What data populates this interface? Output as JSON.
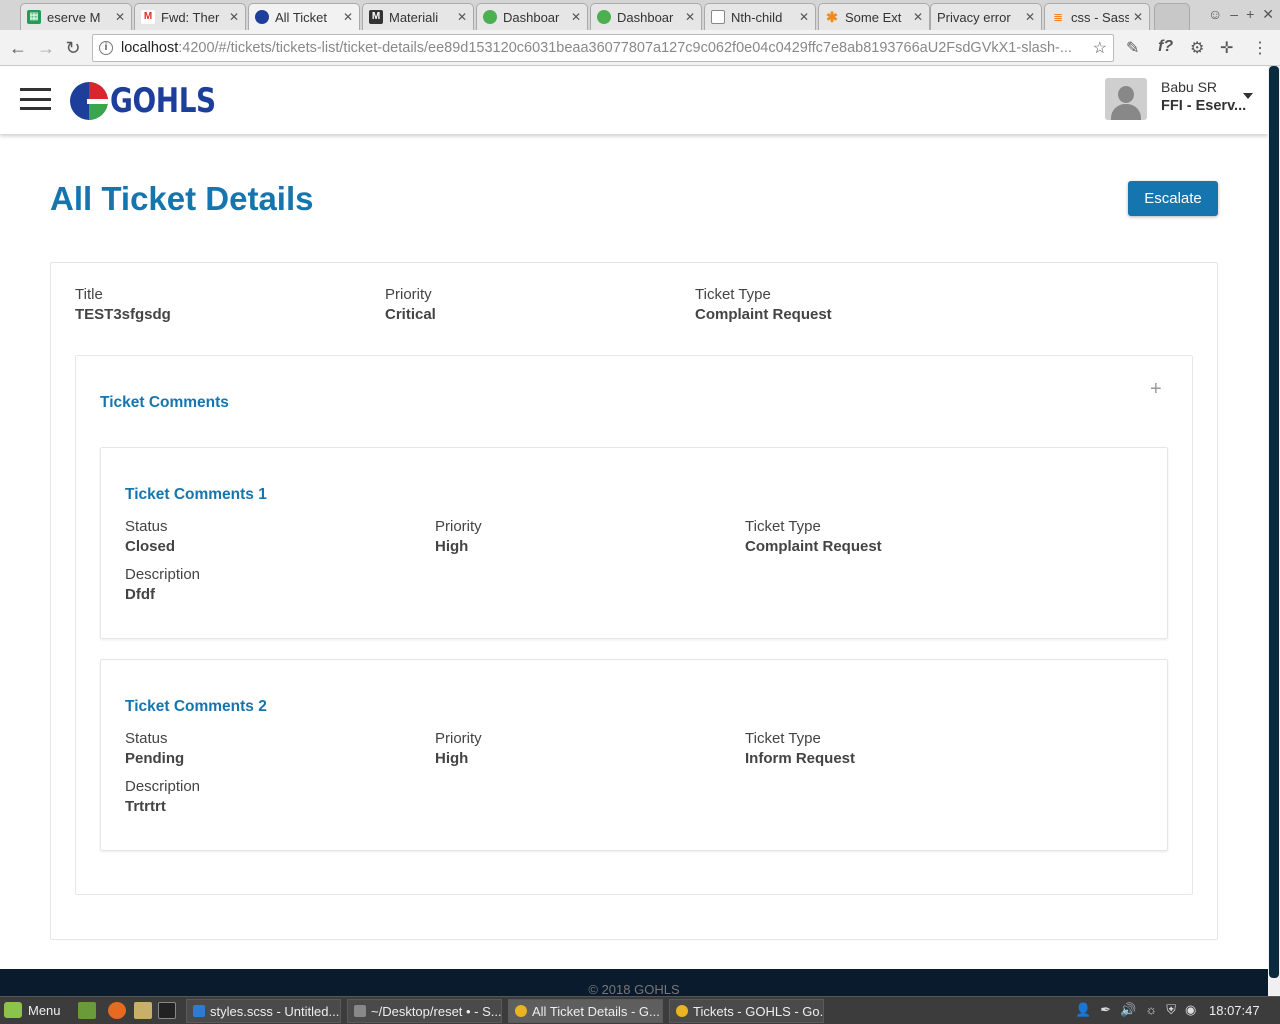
{
  "browser": {
    "tabs": [
      {
        "label": "eserve M",
        "icon": "sheets-icon",
        "color": "#1e9e57"
      },
      {
        "label": "Fwd: Ther",
        "icon": "gmail-icon",
        "color": "#d93025"
      },
      {
        "label": "All Ticket",
        "icon": "gohls-icon",
        "color": "#1d3f9b",
        "active": true
      },
      {
        "label": "Materiali",
        "icon": "materialize-icon",
        "color": "#333333"
      },
      {
        "label": "Dashboar",
        "icon": "dashboard-icon",
        "color": "#4caf50"
      },
      {
        "label": "Dashboar",
        "icon": "dashboard-icon",
        "color": "#4caf50"
      },
      {
        "label": "Nth-child",
        "icon": "page-icon",
        "color": "#888888"
      },
      {
        "label": "Some Ext",
        "icon": "asterisk-icon",
        "color": "#f08c1b"
      },
      {
        "label": "Privacy error",
        "icon": "",
        "color": ""
      },
      {
        "label": "css - Sass",
        "icon": "stackoverflow-icon",
        "color": "#f48024"
      }
    ],
    "url_host": "localhost",
    "url_path": ":4200/#/tickets/tickets-list/ticket-details/ee89d153120c6031beaa36077807a127c9c062f0e04c0429ffc7e8ab8193766aU2FsdGVkX1-slash-..."
  },
  "header": {
    "logo_text": "GOHLS",
    "user_name": "Babu SR",
    "user_org": "FFI - Eserv..."
  },
  "page": {
    "title": "All Ticket Details",
    "escalate_label": "Escalate"
  },
  "ticket": {
    "title_label": "Title",
    "title_value": "TEST3sfgsdg",
    "priority_label": "Priority",
    "priority_value": "Critical",
    "type_label": "Ticket Type",
    "type_value": "Complaint Request"
  },
  "comments_section": {
    "title": "Ticket Comments",
    "add_symbol": "+",
    "items": [
      {
        "title": "Ticket Comments 1",
        "status_label": "Status",
        "status_value": "Closed",
        "priority_label": "Priority",
        "priority_value": "High",
        "type_label": "Ticket Type",
        "type_value": "Complaint Request",
        "desc_label": "Description",
        "desc_value": "Dfdf"
      },
      {
        "title": "Ticket Comments 2",
        "status_label": "Status",
        "status_value": "Pending",
        "priority_label": "Priority",
        "priority_value": "High",
        "type_label": "Ticket Type",
        "type_value": "Inform Request",
        "desc_label": "Description",
        "desc_value": "Trtrtrt"
      }
    ]
  },
  "footer": {
    "copyright": "© 2018 GOHLS"
  },
  "taskbar": {
    "menu_label": "Menu",
    "windows": [
      {
        "label": "styles.scss - Untitled...",
        "color": "#2f7bd3"
      },
      {
        "label": "~/Desktop/reset • - S...",
        "color": "#888888"
      },
      {
        "label": "All Ticket Details - G...",
        "color": "#e9b424",
        "active": true
      },
      {
        "label": "Tickets - GOHLS - Go...",
        "color": "#e9b424"
      }
    ],
    "clock": "18:07:47"
  },
  "colors": {
    "accent": "#1575ae",
    "footer_bg": "#0a1b2e"
  }
}
